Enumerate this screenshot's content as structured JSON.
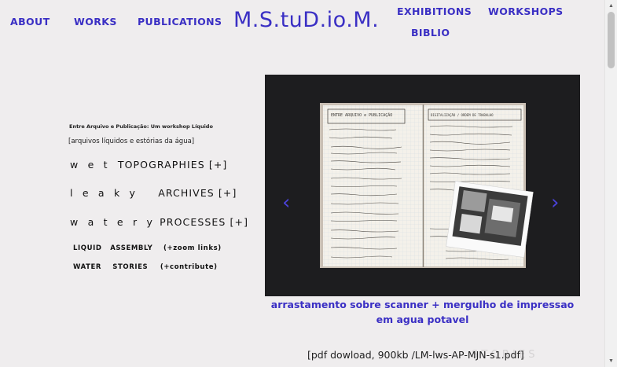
{
  "nav": {
    "about": "ABOUT",
    "works": "WORKS",
    "publications": "PUBLICATIONS",
    "exhibitions": "EXHIBITIONS",
    "workshops": "WORKSHOPS",
    "biblio": "BIBLIO"
  },
  "site_title": "M.S.tuD.io.M.",
  "sidebar": {
    "subtitle": "Entre Arquivo e Publicação: Um workshop Líquido",
    "tagline": "[arquivos líquidos e estórias da água]",
    "topographies_prefix": "w e t",
    "topographies_label": "TOPOGRAPHIES [+]",
    "archives_prefix": "l e a k y",
    "archives_label": "ARCHIVES [+]",
    "processes_prefix": "w a t e r y",
    "processes_label": "PROCESSES [+]",
    "liquid_assembly": "LIQUID   ASSEMBLY",
    "zoom_links": "(+zoom links)",
    "water_stories": "WATER    STORIES",
    "contribute": "(+contribute)"
  },
  "slider": {
    "prev_arrow": "‹",
    "next_arrow": "›",
    "notebook_left_title": "ENTRE ARQUIVO e PUBLICAÇÃO",
    "notebook_right_title": "DIGITALIZAÇÃO / ORDEM DE TRABALHO"
  },
  "caption": "arrastamento sobre scanner + mergulho de impressao em agua potavel",
  "ghost_text": "S T O R I E S",
  "pdf_link": "[pdf dowload, 900kb /LM-lws-AP-MJN-s1.pdf]",
  "colors": {
    "accent": "#3a2fc4",
    "background": "#efedee",
    "slider_bg": "#1d1d1f"
  },
  "icons": {
    "scroll_up": "▲",
    "scroll_down": "▼"
  }
}
